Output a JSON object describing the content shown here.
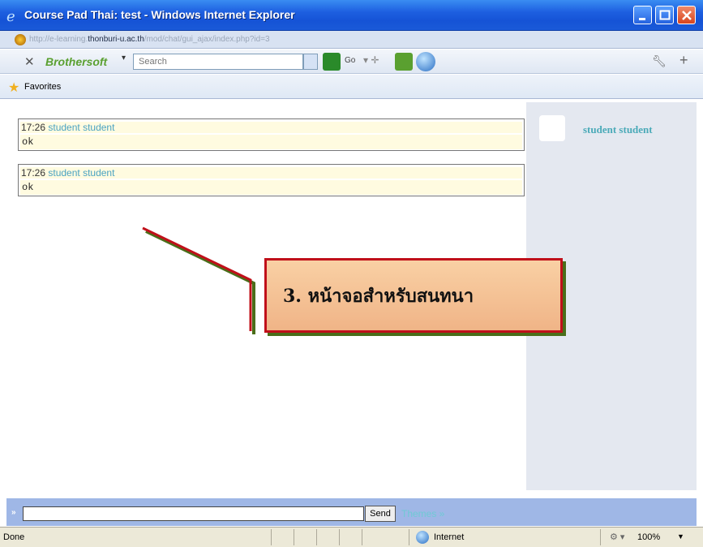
{
  "window": {
    "title": "Course Pad Thai: test - Windows Internet Explorer",
    "icon": "ie-logo-icon"
  },
  "address": {
    "url_prefix": "http://e-learning.",
    "url_host": "thonburi-u.ac.th",
    "url_path": "/mod/chat/gui_ajax/index.php?id=3"
  },
  "toolbar": {
    "brand": "Brothersoft",
    "search_placeholder": "Search",
    "go_label": "Go"
  },
  "favorites": {
    "label": "Favorites"
  },
  "messages": [
    {
      "time": "17:26",
      "user": "student student",
      "text": "ok"
    },
    {
      "time": "17:26",
      "user": "student student",
      "text": "ok"
    }
  ],
  "users_panel": {
    "users": [
      {
        "name": "student student"
      }
    ]
  },
  "annotation": {
    "label": "3. หน้าจอสำหรับสนทนา",
    "border_color": "#c0101a",
    "fill_color": "#f5c39a"
  },
  "input_bar": {
    "prompt": "»",
    "send_label": "Send",
    "themes_label": "Themes »"
  },
  "status": {
    "text": "Done",
    "zone": "Internet",
    "zoom": "100%"
  },
  "colors": {
    "titlebar": "#1d5fe0",
    "username": "#4ba3c2",
    "message_bg": "#fffbe0",
    "users_panel_bg": "#e4e8f0",
    "input_bar_bg": "#9fb7e6"
  }
}
